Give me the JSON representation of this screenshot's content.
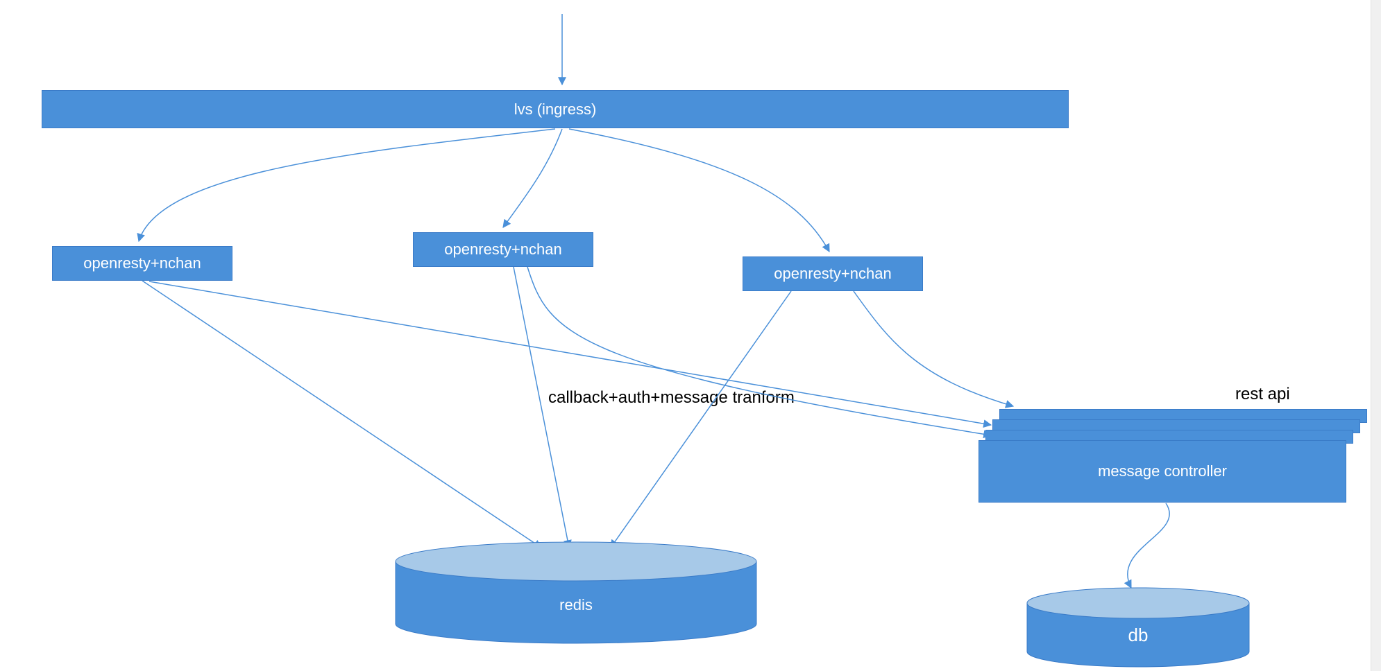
{
  "nodes": {
    "ingress": "lvs (ingress)",
    "openresty1": "openresty+nchan",
    "openresty2": "openresty+nchan",
    "openresty3": "openresty+nchan",
    "controller": "message controller",
    "redis": "redis",
    "db": "db"
  },
  "labels": {
    "callback": "callback+auth+message tranform",
    "restapi": "rest api"
  },
  "colors": {
    "box_fill": "#4a90d9",
    "box_stroke": "#3a7bc8",
    "cyl_top": "#a7c9e8",
    "arrow": "#4a90d9"
  }
}
